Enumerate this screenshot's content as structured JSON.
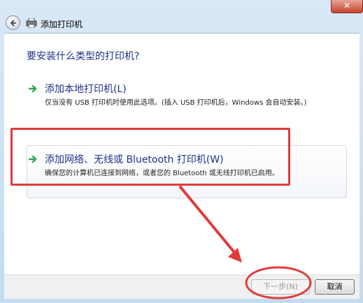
{
  "window": {
    "title": "添加打印机",
    "close_glyph": "✕"
  },
  "main": {
    "heading": "要安装什么类型的打印机?",
    "options": [
      {
        "title": "添加本地打印机(L)",
        "description": "仅当没有 USB 打印机时使用此选项。(插入 USB 打印机后，Windows 会自动安装。)"
      },
      {
        "title": "添加网络、无线或 Bluetooth 打印机(W)",
        "description": "确保您的计算机已连接到网络，或者您的 Bluetooth 或无线打印机已启用。"
      }
    ]
  },
  "footer": {
    "next_label": "下一步(N)",
    "cancel_label": "取消"
  },
  "colors": {
    "heading": "#1e3287",
    "annotation": "#e23b3b",
    "arrow": "#2fa84f"
  }
}
